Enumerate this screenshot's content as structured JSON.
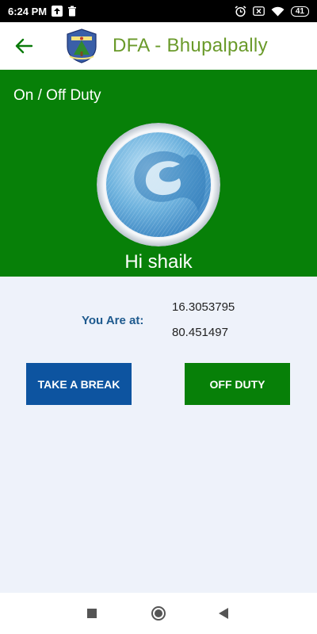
{
  "status_bar": {
    "time": "6:24 PM",
    "battery": "41",
    "icons": [
      "upload-icon",
      "trash-icon",
      "alarm-icon",
      "x-box-icon",
      "wifi-icon",
      "battery-icon"
    ]
  },
  "app_bar": {
    "title": "DFA - Bhupalpally",
    "back_icon": "arrow-left-icon",
    "logo_icon": "forest-department-emblem"
  },
  "header": {
    "section_label": "On / Off Duty",
    "greeting": "Hi shaik",
    "background_color": "#078008"
  },
  "location": {
    "label": "You Are at:",
    "latitude": "16.3053795",
    "longitude": "80.451497"
  },
  "actions": {
    "break_label": "TAKE A BREAK",
    "off_duty_label": "OFF DUTY",
    "break_color": "#0d54a0",
    "off_duty_color": "#078008"
  },
  "nav_bar": {
    "icons": [
      "square-icon",
      "circle-icon",
      "triangle-back-icon"
    ]
  }
}
